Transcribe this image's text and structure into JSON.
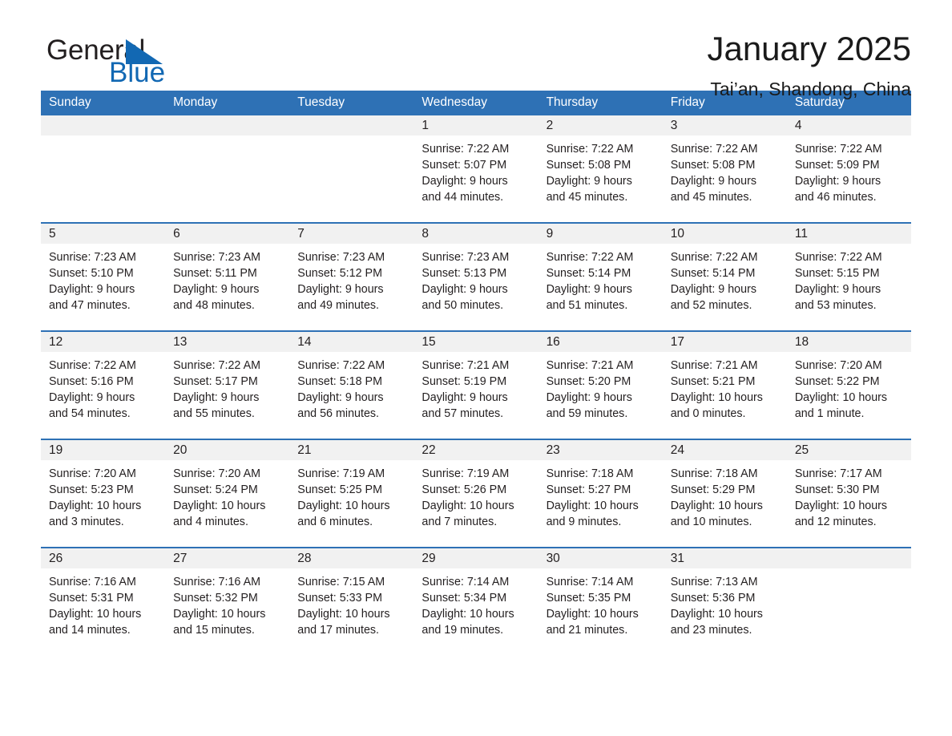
{
  "brand": {
    "name_part1": "General",
    "name_part2": "Blue",
    "logo_icon": "triangle-flag-icon",
    "accent_color": "#1268b3"
  },
  "header": {
    "title": "January 2025",
    "location": "Tai’an, Shandong, China"
  },
  "theme": {
    "header_blue": "#2e71b5",
    "row_divider": "#2e71b5",
    "daynum_band": "#f1f1f1"
  },
  "calendar": {
    "weekday_headers": [
      "Sunday",
      "Monday",
      "Tuesday",
      "Wednesday",
      "Thursday",
      "Friday",
      "Saturday"
    ],
    "weeks": [
      [
        {
          "day": "",
          "empty": true
        },
        {
          "day": "",
          "empty": true
        },
        {
          "day": "",
          "empty": true
        },
        {
          "day": "1",
          "sunrise": "Sunrise: 7:22 AM",
          "sunset": "Sunset: 5:07 PM",
          "daylight_line1": "Daylight: 9 hours",
          "daylight_line2": "and 44 minutes."
        },
        {
          "day": "2",
          "sunrise": "Sunrise: 7:22 AM",
          "sunset": "Sunset: 5:08 PM",
          "daylight_line1": "Daylight: 9 hours",
          "daylight_line2": "and 45 minutes."
        },
        {
          "day": "3",
          "sunrise": "Sunrise: 7:22 AM",
          "sunset": "Sunset: 5:08 PM",
          "daylight_line1": "Daylight: 9 hours",
          "daylight_line2": "and 45 minutes."
        },
        {
          "day": "4",
          "sunrise": "Sunrise: 7:22 AM",
          "sunset": "Sunset: 5:09 PM",
          "daylight_line1": "Daylight: 9 hours",
          "daylight_line2": "and 46 minutes."
        }
      ],
      [
        {
          "day": "5",
          "sunrise": "Sunrise: 7:23 AM",
          "sunset": "Sunset: 5:10 PM",
          "daylight_line1": "Daylight: 9 hours",
          "daylight_line2": "and 47 minutes."
        },
        {
          "day": "6",
          "sunrise": "Sunrise: 7:23 AM",
          "sunset": "Sunset: 5:11 PM",
          "daylight_line1": "Daylight: 9 hours",
          "daylight_line2": "and 48 minutes."
        },
        {
          "day": "7",
          "sunrise": "Sunrise: 7:23 AM",
          "sunset": "Sunset: 5:12 PM",
          "daylight_line1": "Daylight: 9 hours",
          "daylight_line2": "and 49 minutes."
        },
        {
          "day": "8",
          "sunrise": "Sunrise: 7:23 AM",
          "sunset": "Sunset: 5:13 PM",
          "daylight_line1": "Daylight: 9 hours",
          "daylight_line2": "and 50 minutes."
        },
        {
          "day": "9",
          "sunrise": "Sunrise: 7:22 AM",
          "sunset": "Sunset: 5:14 PM",
          "daylight_line1": "Daylight: 9 hours",
          "daylight_line2": "and 51 minutes."
        },
        {
          "day": "10",
          "sunrise": "Sunrise: 7:22 AM",
          "sunset": "Sunset: 5:14 PM",
          "daylight_line1": "Daylight: 9 hours",
          "daylight_line2": "and 52 minutes."
        },
        {
          "day": "11",
          "sunrise": "Sunrise: 7:22 AM",
          "sunset": "Sunset: 5:15 PM",
          "daylight_line1": "Daylight: 9 hours",
          "daylight_line2": "and 53 minutes."
        }
      ],
      [
        {
          "day": "12",
          "sunrise": "Sunrise: 7:22 AM",
          "sunset": "Sunset: 5:16 PM",
          "daylight_line1": "Daylight: 9 hours",
          "daylight_line2": "and 54 minutes."
        },
        {
          "day": "13",
          "sunrise": "Sunrise: 7:22 AM",
          "sunset": "Sunset: 5:17 PM",
          "daylight_line1": "Daylight: 9 hours",
          "daylight_line2": "and 55 minutes."
        },
        {
          "day": "14",
          "sunrise": "Sunrise: 7:22 AM",
          "sunset": "Sunset: 5:18 PM",
          "daylight_line1": "Daylight: 9 hours",
          "daylight_line2": "and 56 minutes."
        },
        {
          "day": "15",
          "sunrise": "Sunrise: 7:21 AM",
          "sunset": "Sunset: 5:19 PM",
          "daylight_line1": "Daylight: 9 hours",
          "daylight_line2": "and 57 minutes."
        },
        {
          "day": "16",
          "sunrise": "Sunrise: 7:21 AM",
          "sunset": "Sunset: 5:20 PM",
          "daylight_line1": "Daylight: 9 hours",
          "daylight_line2": "and 59 minutes."
        },
        {
          "day": "17",
          "sunrise": "Sunrise: 7:21 AM",
          "sunset": "Sunset: 5:21 PM",
          "daylight_line1": "Daylight: 10 hours",
          "daylight_line2": "and 0 minutes."
        },
        {
          "day": "18",
          "sunrise": "Sunrise: 7:20 AM",
          "sunset": "Sunset: 5:22 PM",
          "daylight_line1": "Daylight: 10 hours",
          "daylight_line2": "and 1 minute."
        }
      ],
      [
        {
          "day": "19",
          "sunrise": "Sunrise: 7:20 AM",
          "sunset": "Sunset: 5:23 PM",
          "daylight_line1": "Daylight: 10 hours",
          "daylight_line2": "and 3 minutes."
        },
        {
          "day": "20",
          "sunrise": "Sunrise: 7:20 AM",
          "sunset": "Sunset: 5:24 PM",
          "daylight_line1": "Daylight: 10 hours",
          "daylight_line2": "and 4 minutes."
        },
        {
          "day": "21",
          "sunrise": "Sunrise: 7:19 AM",
          "sunset": "Sunset: 5:25 PM",
          "daylight_line1": "Daylight: 10 hours",
          "daylight_line2": "and 6 minutes."
        },
        {
          "day": "22",
          "sunrise": "Sunrise: 7:19 AM",
          "sunset": "Sunset: 5:26 PM",
          "daylight_line1": "Daylight: 10 hours",
          "daylight_line2": "and 7 minutes."
        },
        {
          "day": "23",
          "sunrise": "Sunrise: 7:18 AM",
          "sunset": "Sunset: 5:27 PM",
          "daylight_line1": "Daylight: 10 hours",
          "daylight_line2": "and 9 minutes."
        },
        {
          "day": "24",
          "sunrise": "Sunrise: 7:18 AM",
          "sunset": "Sunset: 5:29 PM",
          "daylight_line1": "Daylight: 10 hours",
          "daylight_line2": "and 10 minutes."
        },
        {
          "day": "25",
          "sunrise": "Sunrise: 7:17 AM",
          "sunset": "Sunset: 5:30 PM",
          "daylight_line1": "Daylight: 10 hours",
          "daylight_line2": "and 12 minutes."
        }
      ],
      [
        {
          "day": "26",
          "sunrise": "Sunrise: 7:16 AM",
          "sunset": "Sunset: 5:31 PM",
          "daylight_line1": "Daylight: 10 hours",
          "daylight_line2": "and 14 minutes."
        },
        {
          "day": "27",
          "sunrise": "Sunrise: 7:16 AM",
          "sunset": "Sunset: 5:32 PM",
          "daylight_line1": "Daylight: 10 hours",
          "daylight_line2": "and 15 minutes."
        },
        {
          "day": "28",
          "sunrise": "Sunrise: 7:15 AM",
          "sunset": "Sunset: 5:33 PM",
          "daylight_line1": "Daylight: 10 hours",
          "daylight_line2": "and 17 minutes."
        },
        {
          "day": "29",
          "sunrise": "Sunrise: 7:14 AM",
          "sunset": "Sunset: 5:34 PM",
          "daylight_line1": "Daylight: 10 hours",
          "daylight_line2": "and 19 minutes."
        },
        {
          "day": "30",
          "sunrise": "Sunrise: 7:14 AM",
          "sunset": "Sunset: 5:35 PM",
          "daylight_line1": "Daylight: 10 hours",
          "daylight_line2": "and 21 minutes."
        },
        {
          "day": "31",
          "sunrise": "Sunrise: 7:13 AM",
          "sunset": "Sunset: 5:36 PM",
          "daylight_line1": "Daylight: 10 hours",
          "daylight_line2": "and 23 minutes."
        },
        {
          "day": "",
          "empty": true
        }
      ]
    ]
  }
}
